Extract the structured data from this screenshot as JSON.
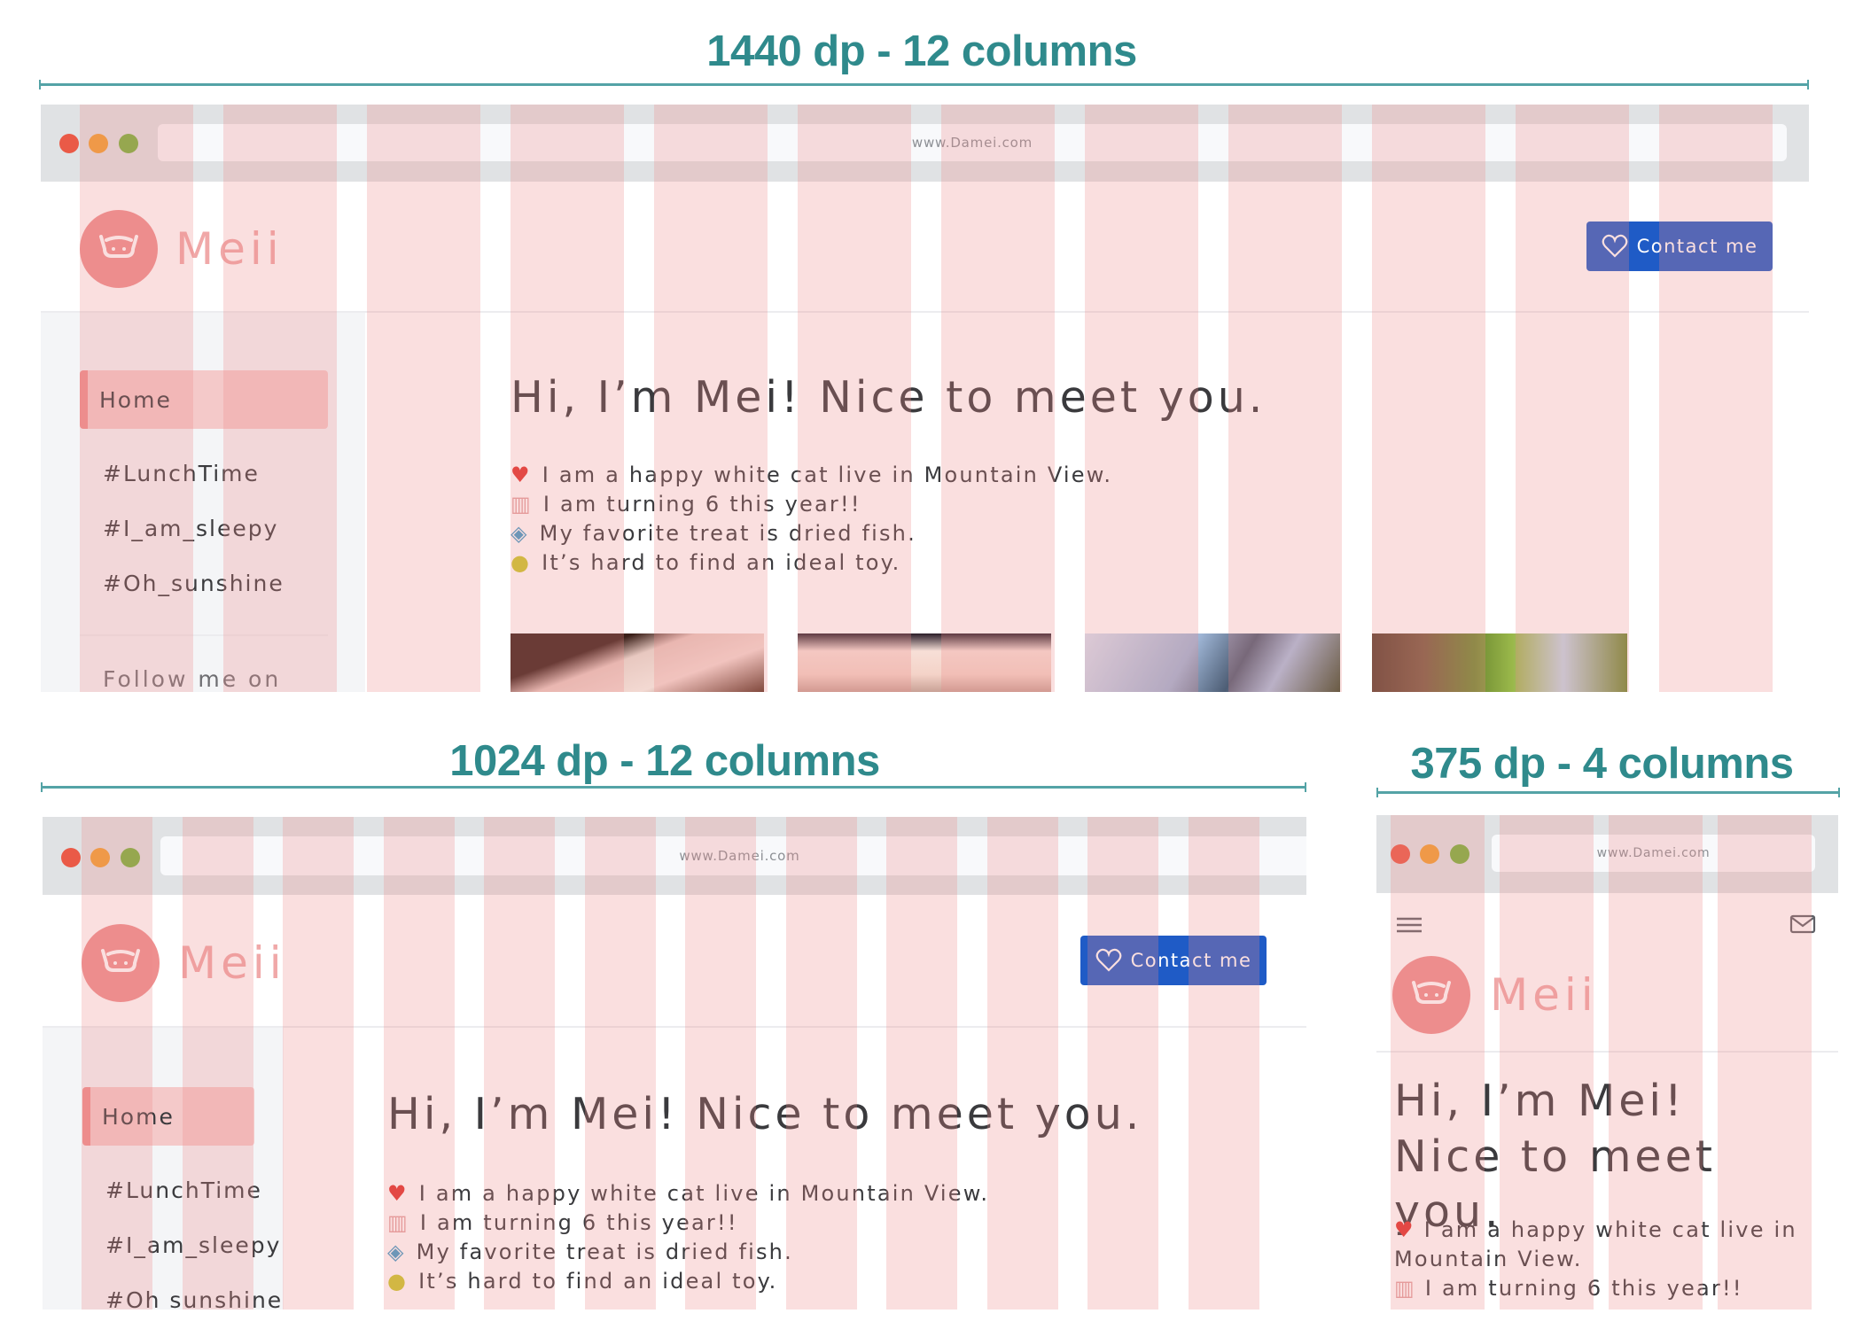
{
  "titles": {
    "desktop": "1440 dp - 12 columns",
    "tablet": "1024 dp - 12 columns",
    "mobile": "375 dp - 4 columns"
  },
  "site": {
    "url": "www.Damei.com",
    "logo_text": "Meii",
    "contact_label": "Contact me",
    "nav": [
      "Home",
      "#LunchTime",
      "#I_am_sleepy",
      "#Oh_sunshine"
    ],
    "nav_tablet_last": "#Oh sunshine",
    "follow_label": "Follow me on",
    "heading": "Hi, I’m Mei! Nice to meet you.",
    "bullets": [
      {
        "icon": "heart-icon",
        "text": "I am a happy white cat live in Mountain View."
      },
      {
        "icon": "cake-icon",
        "text": "I am turning 6 this year!!"
      },
      {
        "icon": "fish-icon",
        "text": "My favorite treat is dried fish."
      },
      {
        "icon": "ball-icon",
        "text": "It’s hard to find an ideal toy."
      }
    ]
  },
  "grid": {
    "desktop_columns": 12,
    "tablet_columns": 12,
    "mobile_columns": 4
  },
  "colors": {
    "title": "#2f8a8c",
    "grid_overlay": "#ee8a8a",
    "logo": "#ee8f8f",
    "button": "#1f5bc6",
    "dot_red": "#ea5a47",
    "dot_yellow": "#f0a030",
    "dot_green": "#76b33a"
  }
}
